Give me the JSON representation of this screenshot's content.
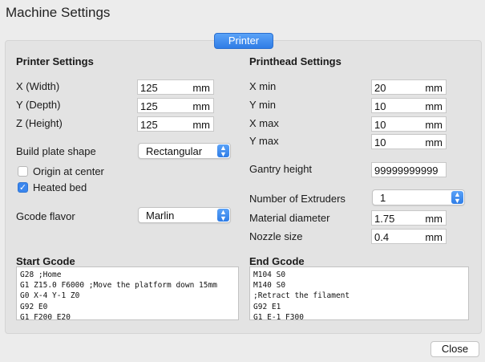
{
  "window": {
    "title": "Machine Settings"
  },
  "tabs": [
    {
      "label": "Printer",
      "active": true
    }
  ],
  "printer_settings": {
    "title": "Printer Settings",
    "width_label": "X (Width)",
    "width_value": "125",
    "width_unit": "mm",
    "depth_label": "Y (Depth)",
    "depth_value": "125",
    "depth_unit": "mm",
    "height_label": "Z (Height)",
    "height_value": "125",
    "height_unit": "mm",
    "build_plate_label": "Build plate shape",
    "build_plate_value": "Rectangular",
    "origin_label": "Origin at center",
    "origin_checked": false,
    "heated_bed_label": "Heated bed",
    "heated_bed_checked": true,
    "gcode_flavor_label": "Gcode flavor",
    "gcode_flavor_value": "Marlin"
  },
  "printhead_settings": {
    "title": "Printhead Settings",
    "xmin_label": "X min",
    "xmin_value": "20",
    "xmin_unit": "mm",
    "ymin_label": "Y min",
    "ymin_value": "10",
    "ymin_unit": "mm",
    "xmax_label": "X max",
    "xmax_value": "10",
    "xmax_unit": "mm",
    "ymax_label": "Y max",
    "ymax_value": "10",
    "ymax_unit": "mm",
    "gantry_label": "Gantry height",
    "gantry_value": "99999999999",
    "extruders_label": "Number of Extruders",
    "extruders_value": "1",
    "material_label": "Material diameter",
    "material_value": "1.75",
    "material_unit": "mm",
    "nozzle_label": "Nozzle size",
    "nozzle_value": "0.4",
    "nozzle_unit": "mm"
  },
  "start_gcode": {
    "title": "Start Gcode",
    "lines": [
      "G28 ;Home",
      "G1 Z15.0 F6000 ;Move the platform down 15mm",
      "G0 X-4 Y-1 Z0",
      "G92 E0",
      "G1 F200 E20"
    ]
  },
  "end_gcode": {
    "title": "End Gcode",
    "lines": [
      "M104 S0",
      "M140 S0",
      ";Retract the filament",
      "G92 E1",
      "G1 E-1 F300"
    ]
  },
  "footer": {
    "close_label": "Close"
  },
  "colors": {
    "accent": "#3a86ee",
    "panel": "#e3e3e3",
    "window": "#ececec"
  }
}
